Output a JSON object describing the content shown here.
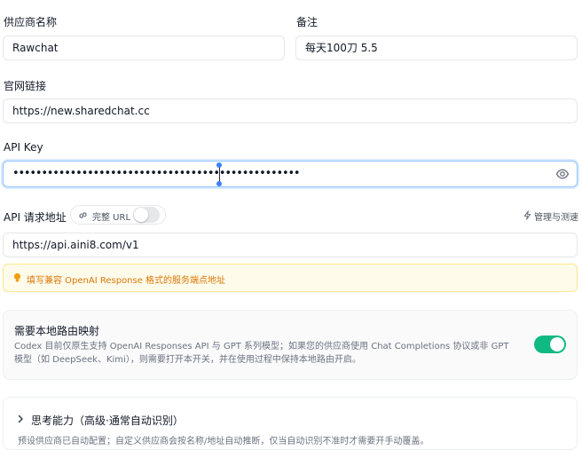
{
  "provider": {
    "name_label": "供应商名称",
    "name_value": "Rawchat",
    "note_label": "备注",
    "note_value": "每天100刀 5.5"
  },
  "website": {
    "label": "官网链接",
    "value": "https://new.sharedchat.cc"
  },
  "api_key": {
    "label": "API Key",
    "masked_value": "••••••••••••••••••••••••••••••••••••••••••••••••••",
    "eye_icon": "eye-icon"
  },
  "endpoint": {
    "label": "API 请求地址",
    "full_url_label": "完整 URL",
    "full_url_enabled": false,
    "manage_label": "管理与测速",
    "value": "https://api.aini8.com/v1",
    "hint": "填写兼容 OpenAI Response 格式的服务端点地址"
  },
  "local_routing": {
    "title": "需要本地路由映射",
    "description": "Codex 目前仅原生支持 OpenAI Responses API 与 GPT 系列模型；如果您的供应商使用 Chat Completions 协议或非 GPT 模型（如 DeepSeek、Kimi），则需要打开本开关，并在使用过程中保持本地路由开启。",
    "enabled": true
  },
  "thinking": {
    "title": "思考能力（高级·通常自动识别）",
    "description": "预设供应商已自动配置；自定义供应商会按名称/地址自动推断，仅当自动识别不准时才需要开手动覆盖。"
  },
  "colors": {
    "accent": "#3b82f6",
    "toggle_on": "#10b981",
    "hint_bg": "#fffbeb",
    "hint_text": "#d97706"
  }
}
